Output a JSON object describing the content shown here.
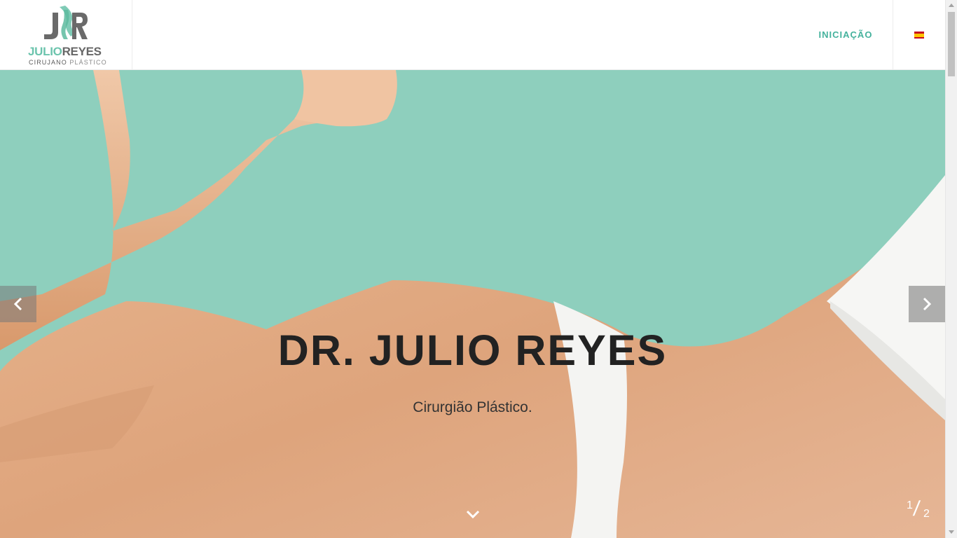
{
  "logo": {
    "monogram": "JR",
    "name_part1": "JULIO",
    "name_part2": "REYES",
    "subtitle_part1": "CIRUJANO",
    "subtitle_part2": "PLÁSTICO"
  },
  "nav": {
    "home_label": "INICIAÇÃO",
    "language_flag": "flag-spain-icon"
  },
  "hero": {
    "title": "DR. JULIO REYES",
    "subtitle": "Cirurgião Plástico.",
    "slide_current": "1",
    "slide_total": "2"
  },
  "colors": {
    "accent": "#45b29d",
    "hero_background": "#8ecfbd",
    "logo_teal": "#6cc4ad",
    "logo_gray": "#676767"
  }
}
